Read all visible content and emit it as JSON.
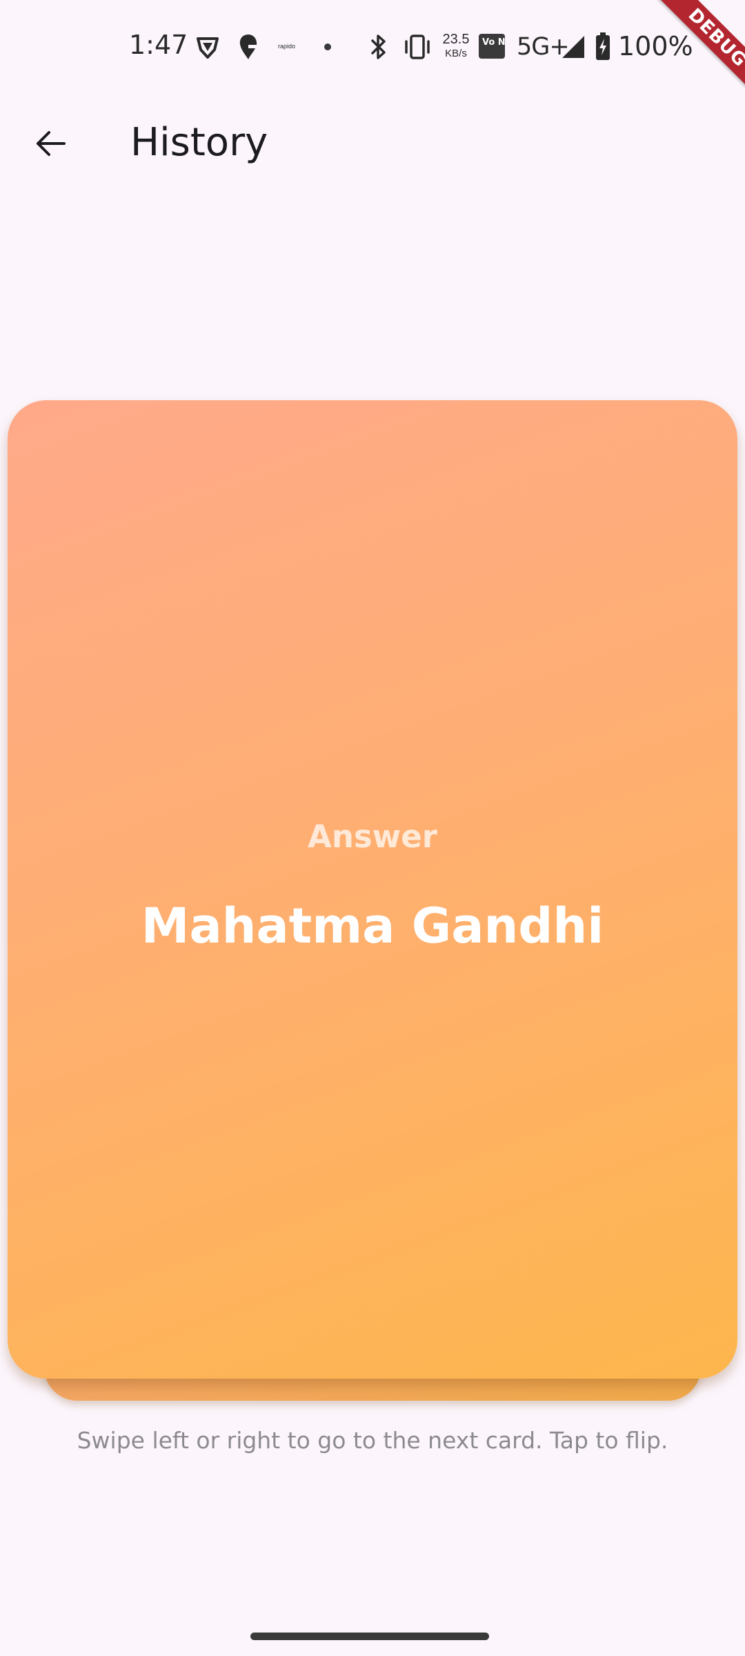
{
  "status_bar": {
    "time": "1:47",
    "rapido_label": "rapido",
    "speed_value": "23.5",
    "speed_unit": "KB/s",
    "vonr_label": "Vo NR",
    "network": "5G+",
    "battery": "100%"
  },
  "debug_banner": "DEBUG",
  "app_bar": {
    "back_icon": "arrow-back-icon",
    "title": "History"
  },
  "card": {
    "side_label": "Answer",
    "content": "Mahatma Gandhi",
    "colors": {
      "gradient_start": "#ffa98a",
      "gradient_end": "#fdb64d"
    }
  },
  "hint": "Swipe left or right to go to the next card. Tap to flip."
}
